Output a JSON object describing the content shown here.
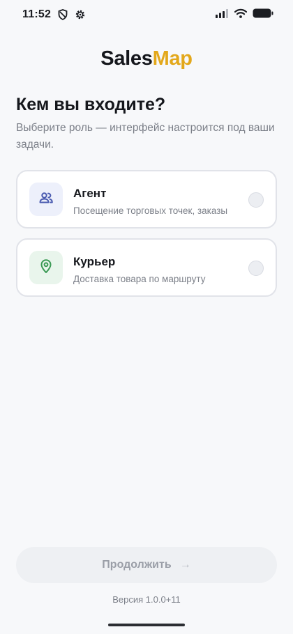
{
  "status_bar": {
    "time": "11:52",
    "icons": [
      "shield-icon",
      "gear-icon",
      "signal-icon",
      "wifi-icon",
      "battery-icon"
    ]
  },
  "logo": {
    "part1": "Sales",
    "part2": "Map",
    "accent_color": "#e3a81b"
  },
  "heading": {
    "title": "Кем вы входите?",
    "subtitle": "Выберите роль — интерфейс настроится под ваши задачи."
  },
  "roles": [
    {
      "name": "Агент",
      "description": "Посещение торговых точек, заказы",
      "icon": "people-icon",
      "icon_color": "#4a5bb0",
      "selected": false
    },
    {
      "name": "Курьер",
      "description": "Доставка товара по маршруту",
      "icon": "location-pin-icon",
      "icon_color": "#3b9a55",
      "selected": false
    }
  ],
  "continue_button": {
    "label": "Продолжить",
    "arrow": "→",
    "enabled": false
  },
  "footer": {
    "version": "Версия 1.0.0+11"
  }
}
